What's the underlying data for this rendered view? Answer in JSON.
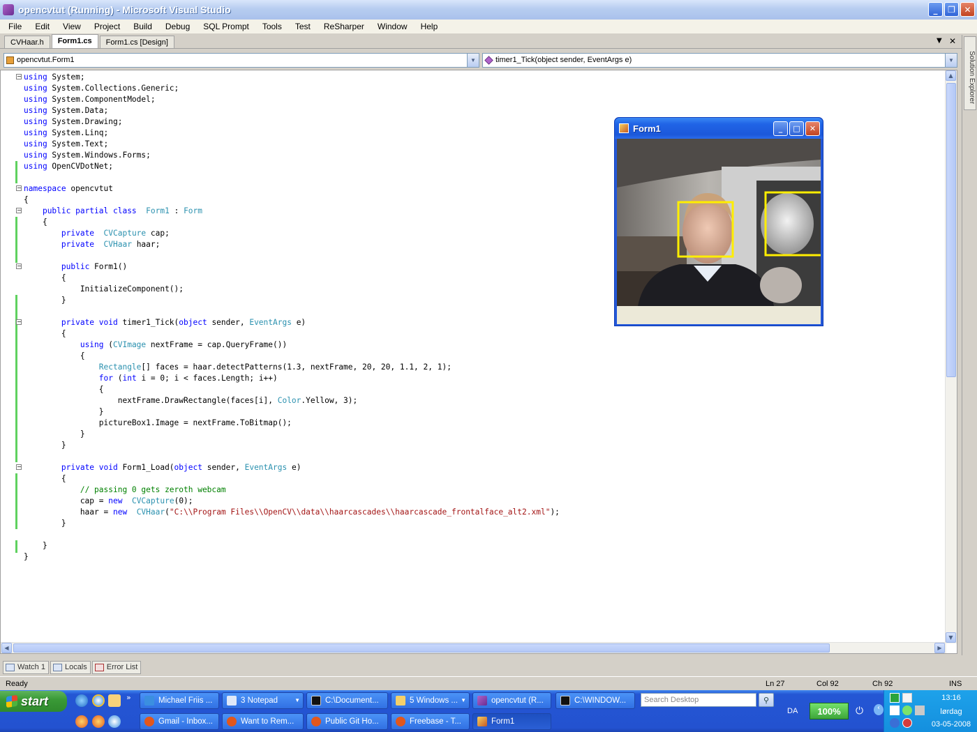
{
  "window": {
    "title": "opencvtut (Running) - Microsoft Visual Studio"
  },
  "menu": [
    "File",
    "Edit",
    "View",
    "Project",
    "Build",
    "Debug",
    "SQL Prompt",
    "Tools",
    "Test",
    "ReSharper",
    "Window",
    "Help"
  ],
  "tabs": [
    {
      "label": "CVHaar.h"
    },
    {
      "label": "Form1.cs"
    },
    {
      "label": "Form1.cs [Design]"
    }
  ],
  "dropdowns": {
    "left": "opencvtut.Form1",
    "right": "timer1_Tick(object sender, EventArgs e)"
  },
  "code_lines": [
    [
      [
        "kw",
        "using"
      ],
      [
        "",
        "System;"
      ]
    ],
    [
      [
        "kw",
        "using"
      ],
      [
        "",
        "System.Collections.Generic;"
      ]
    ],
    [
      [
        "kw",
        "using"
      ],
      [
        "",
        "System.ComponentModel;"
      ]
    ],
    [
      [
        "kw",
        "using"
      ],
      [
        "",
        "System.Data;"
      ]
    ],
    [
      [
        "kw",
        "using"
      ],
      [
        "",
        "System.Drawing;"
      ]
    ],
    [
      [
        "kw",
        "using"
      ],
      [
        "",
        "System.Linq;"
      ]
    ],
    [
      [
        "kw",
        "using"
      ],
      [
        "",
        "System.Text;"
      ]
    ],
    [
      [
        "kw",
        "using"
      ],
      [
        "",
        "System.Windows.Forms;"
      ]
    ],
    [
      [
        "kw",
        "using"
      ],
      [
        "",
        "OpenCVDotNet;"
      ]
    ],
    [],
    [
      [
        "kw",
        "namespace"
      ],
      [
        "",
        "opencvtut"
      ]
    ],
    [
      [
        "",
        "{"
      ]
    ],
    [
      [
        "",
        "    "
      ],
      [
        "kw",
        "public partial class"
      ],
      [
        "",
        ""
      ],
      [
        "ty",
        "Form1"
      ],
      [
        "",
        " : "
      ],
      [
        "ty",
        "Form"
      ]
    ],
    [
      [
        "",
        "    {"
      ]
    ],
    [
      [
        "",
        "        "
      ],
      [
        "kw",
        "private"
      ],
      [
        "",
        ""
      ],
      [
        "ty",
        "CVCapture"
      ],
      [
        "",
        " cap;"
      ]
    ],
    [
      [
        "",
        "        "
      ],
      [
        "kw",
        "private"
      ],
      [
        "",
        ""
      ],
      [
        "ty",
        "CVHaar"
      ],
      [
        "",
        " haar;"
      ]
    ],
    [],
    [
      [
        "",
        "        "
      ],
      [
        "kw",
        "public"
      ],
      [
        "",
        " Form1()"
      ]
    ],
    [
      [
        "",
        "        {"
      ]
    ],
    [
      [
        "",
        "            InitializeComponent();"
      ]
    ],
    [
      [
        "",
        "        }"
      ]
    ],
    [],
    [
      [
        "",
        "        "
      ],
      [
        "kw",
        "private void"
      ],
      [
        "",
        " timer1_Tick("
      ],
      [
        "kw",
        "object"
      ],
      [
        "",
        " sender, "
      ],
      [
        "ty",
        "EventArgs"
      ],
      [
        "",
        " e)"
      ]
    ],
    [
      [
        "",
        "        {"
      ]
    ],
    [
      [
        "",
        "            "
      ],
      [
        "kw",
        "using"
      ],
      [
        "",
        " ("
      ],
      [
        "ty",
        "CVImage"
      ],
      [
        "",
        " nextFrame = cap.QueryFrame())"
      ]
    ],
    [
      [
        "",
        "            {"
      ]
    ],
    [
      [
        "",
        "                "
      ],
      [
        "ty",
        "Rectangle"
      ],
      [
        "",
        "[] faces = haar.detectPatterns(1.3, nextFrame, 20, 20, 1.1, 2, 1);"
      ]
    ],
    [
      [
        "",
        "                "
      ],
      [
        "kw",
        "for"
      ],
      [
        "",
        " ("
      ],
      [
        "kw",
        "int"
      ],
      [
        "",
        " i = 0; i < faces.Length; i++)"
      ]
    ],
    [
      [
        "",
        "                {"
      ]
    ],
    [
      [
        "",
        "                    nextFrame.DrawRectangle(faces[i], "
      ],
      [
        "ty",
        "Color"
      ],
      [
        "",
        ".Yellow, 3);"
      ]
    ],
    [
      [
        "",
        "                }"
      ]
    ],
    [
      [
        "",
        "                pictureBox1.Image = nextFrame.ToBitmap();"
      ]
    ],
    [
      [
        "",
        "            }"
      ]
    ],
    [
      [
        "",
        "        }"
      ]
    ],
    [],
    [
      [
        "",
        "        "
      ],
      [
        "kw",
        "private void"
      ],
      [
        "",
        " Form1_Load("
      ],
      [
        "kw",
        "object"
      ],
      [
        "",
        " sender, "
      ],
      [
        "ty",
        "EventArgs"
      ],
      [
        "",
        " e)"
      ]
    ],
    [
      [
        "",
        "        {"
      ]
    ],
    [
      [
        "",
        "            "
      ],
      [
        "cm",
        "// passing 0 gets zeroth webcam"
      ]
    ],
    [
      [
        "",
        "            cap = "
      ],
      [
        "kw",
        "new"
      ],
      [
        "",
        ""
      ],
      [
        "ty",
        "CVCapture"
      ],
      [
        "",
        "(0);"
      ]
    ],
    [
      [
        "",
        "            haar = "
      ],
      [
        "kw",
        "new"
      ],
      [
        "",
        ""
      ],
      [
        "ty",
        "CVHaar"
      ],
      [
        "",
        "("
      ],
      [
        "st",
        "\"C:\\\\Program Files\\\\OpenCV\\\\data\\\\haarcascades\\\\haarcascade_frontalface_alt2.xml\""
      ],
      [
        "",
        ");"
      ]
    ],
    [
      [
        "",
        "        }"
      ]
    ],
    [],
    [
      [
        "",
        "    }"
      ]
    ],
    [
      [
        "",
        "}"
      ]
    ]
  ],
  "side_panel": {
    "label": "Solution Explorer"
  },
  "tool_windows": [
    "Watch 1",
    "Locals",
    "Error List"
  ],
  "status": {
    "ready": "Ready",
    "ln": "Ln 27",
    "col": "Col 92",
    "ch": "Ch 92",
    "ins": "INS"
  },
  "form1": {
    "title": "Form1"
  },
  "taskbar": {
    "start": "start",
    "row1": [
      "Michael Friis ...",
      "3 Notepad",
      "C:\\Document...",
      "5 Windows ...",
      "opencvtut (R...",
      "C:\\WINDOW..."
    ],
    "row2": [
      "Gmail - Inbox...",
      "Want to Rem...",
      "Public Git Ho...",
      "Freebase - T...",
      "Form1"
    ],
    "search_placeholder": "Search Desktop",
    "lang": "DA",
    "zoom": "100%",
    "time": "13:16",
    "day": "lørdag",
    "date": "03-05-2008"
  },
  "colors": {
    "keyword": "#0000ff",
    "type": "#2b91af",
    "comment": "#008000",
    "string": "#a31515",
    "detection_box": "#ffee00"
  }
}
